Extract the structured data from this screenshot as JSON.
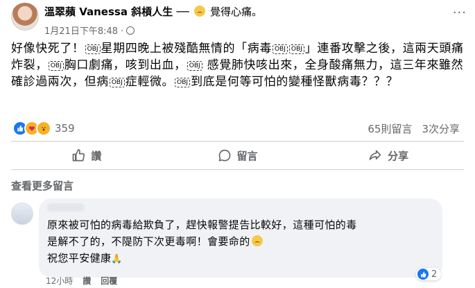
{
  "post": {
    "author": "溫翠蘋 Vanessa 斜槓人生",
    "dash": "──",
    "feeling": "覺得心痛。",
    "timestamp": "1月21日下午8:48 ·",
    "more": "···",
    "text_parts": [
      "好像快死了！",
      "星期四晚上被殘酷無情的「病毒",
      "」連番攻擊之後，這兩天頭痛炸裂，",
      "胸口劇痛，咳到出血，",
      " 感覺肺快咳出來，全身酸痛無力，這三年來雖然確診過兩次，但病",
      "症輕微。",
      "到底是何等可怕的變種怪獸病毒？？？"
    ],
    "tag_label": "OBJ"
  },
  "reactions": {
    "count": "359",
    "comments": "65則留言",
    "shares": "3次分享",
    "icons": [
      "like-icon",
      "care-icon",
      "wow-icon"
    ]
  },
  "actions": {
    "like": "讚",
    "comment": "留言",
    "share": "分享"
  },
  "more_comments": "查看更多留言",
  "comment": {
    "line1": "原來被可怕的病毒給欺負了，趕快報警提告比較好，這種可怕的毒",
    "line2": "是解不了的，不隄防下次更毒啊！會要命的",
    "line3": "祝您平安健康",
    "likes": "2",
    "time": "12小時",
    "like_label": "讚",
    "reply_label": "回覆"
  },
  "colors": {
    "accent": "#1877f2",
    "secondary_text": "#65676b",
    "bubble": "#f0f2f5"
  }
}
